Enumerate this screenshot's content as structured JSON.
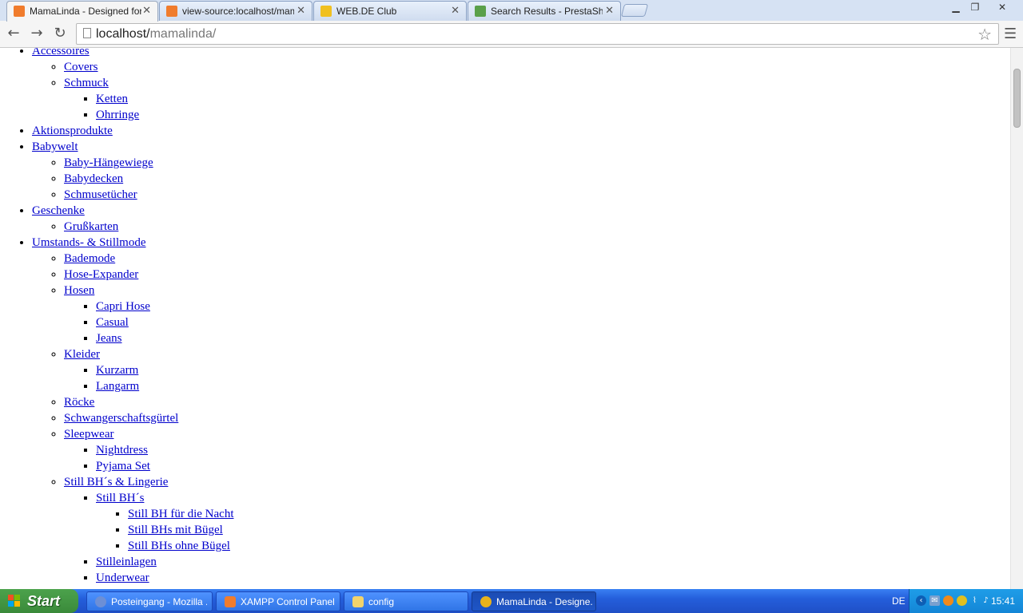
{
  "browser": {
    "tabs": [
      {
        "title": "MamaLinda - Designed for Mo",
        "active": true
      },
      {
        "title": "view-source:localhost/mamal",
        "active": false
      },
      {
        "title": "WEB.DE Club",
        "active": false
      },
      {
        "title": "Search Results - PrestaShop",
        "active": false
      }
    ],
    "url_host": "localhost/",
    "url_path": "mamalinda/"
  },
  "page": {
    "menu": [
      {
        "label": "Accessoires",
        "children": [
          {
            "label": "Covers"
          },
          {
            "label": "Schmuck",
            "children": [
              {
                "label": "Ketten"
              },
              {
                "label": "Ohrringe"
              }
            ]
          }
        ]
      },
      {
        "label": "Aktionsprodukte"
      },
      {
        "label": "Babywelt",
        "children": [
          {
            "label": "Baby-Hängewiege"
          },
          {
            "label": "Babydecken"
          },
          {
            "label": "Schmusetücher"
          }
        ]
      },
      {
        "label": "Geschenke",
        "children": [
          {
            "label": "Grußkarten"
          }
        ]
      },
      {
        "label": "Umstands- & Stillmode",
        "children": [
          {
            "label": "Bademode"
          },
          {
            "label": "Hose-Expander"
          },
          {
            "label": "Hosen",
            "children": [
              {
                "label": "Capri Hose"
              },
              {
                "label": "Casual"
              },
              {
                "label": "Jeans"
              }
            ]
          },
          {
            "label": "Kleider",
            "children": [
              {
                "label": "Kurzarm"
              },
              {
                "label": "Langarm"
              }
            ]
          },
          {
            "label": "Röcke"
          },
          {
            "label": "Schwangerschaftsgürtel"
          },
          {
            "label": "Sleepwear",
            "children": [
              {
                "label": "Nightdress"
              },
              {
                "label": "Pyjama Set"
              }
            ]
          },
          {
            "label": "Still BH´s & Lingerie",
            "children": [
              {
                "label": "Still BH´s",
                "children": [
                  {
                    "label": "Still BH für die Nacht"
                  },
                  {
                    "label": "Still BHs mit Bügel"
                  },
                  {
                    "label": "Still BHs ohne Bügel"
                  }
                ]
              },
              {
                "label": "Stilleinlagen"
              },
              {
                "label": "Underwear"
              }
            ]
          }
        ]
      }
    ]
  },
  "taskbar": {
    "start_label": "Start",
    "buttons": [
      {
        "label": "Posteingang - Mozilla ...",
        "active": false
      },
      {
        "label": "XAMPP Control Panel ...",
        "active": false
      },
      {
        "label": "config",
        "active": false
      },
      {
        "label": "MamaLinda - Designe...",
        "active": true
      }
    ],
    "language": "DE",
    "clock": "15:41"
  },
  "colors": {
    "link": "#0000cc",
    "taskbar": "#245edb",
    "start_button": "#3a8a3a",
    "tab_strip": "#d6e2f3"
  }
}
